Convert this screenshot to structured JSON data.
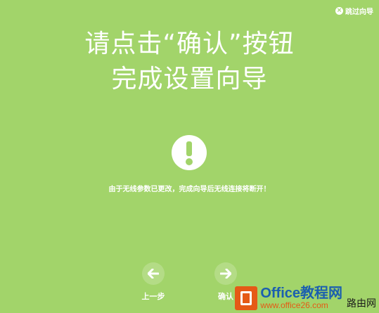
{
  "header": {
    "skip_label": "跳过向导"
  },
  "main": {
    "title_line1": "请点击“确认”按钮",
    "title_line2": "完成设置向导",
    "warning": "由于无线参数已更改，完成向导后无线连接将断开！"
  },
  "nav": {
    "prev_label": "上一步",
    "next_label": "确认"
  },
  "watermark": {
    "brand": "Office教程网",
    "url": "www.office26.com",
    "side": "路由网"
  },
  "colors": {
    "background": "#a2d46a",
    "foreground": "#ffffff"
  }
}
